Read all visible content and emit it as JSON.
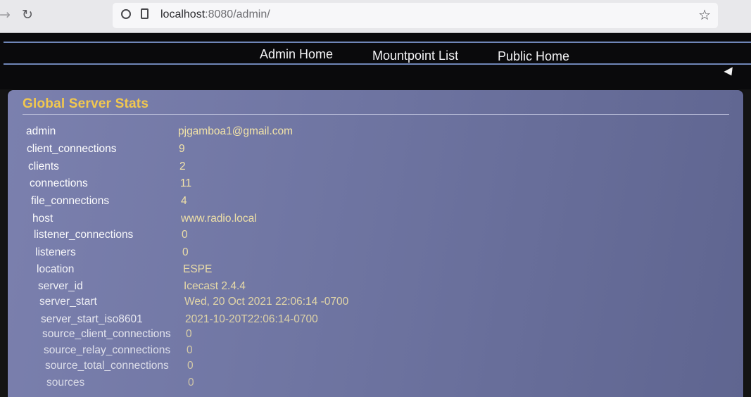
{
  "browser": {
    "url_host": "localhost",
    "url_rest": ":8080/admin/"
  },
  "menu": {
    "admin_home": "Admin Home",
    "mountpoint_list": "Mountpoint List",
    "public_home": "Public Home"
  },
  "stats": {
    "title": "Global Server Stats",
    "rows": [
      {
        "key": "admin",
        "value": "pjgamboa1@gmail.com"
      },
      {
        "key": "client_connections",
        "value": "9"
      },
      {
        "key": "clients",
        "value": "2"
      },
      {
        "key": "connections",
        "value": "11"
      },
      {
        "key": "file_connections",
        "value": "4"
      },
      {
        "key": "host",
        "value": "www.radio.local"
      },
      {
        "key": "listener_connections",
        "value": "0"
      },
      {
        "key": "listeners",
        "value": "0"
      },
      {
        "key": "location",
        "value": "ESPE"
      },
      {
        "key": "server_id",
        "value": "Icecast 2.4.4"
      },
      {
        "key": "server_start",
        "value": "Wed, 20 Oct 2021 22:06:14 -0700"
      },
      {
        "key": "server_start_iso8601",
        "value": "2021-10-20T22:06:14-0700"
      },
      {
        "key": "source_client_connections",
        "value": "0"
      },
      {
        "key": "source_relay_connections",
        "value": "0"
      },
      {
        "key": "source_total_connections",
        "value": "0"
      },
      {
        "key": "sources",
        "value": "0"
      }
    ]
  },
  "colors": {
    "panel_background": "#7076a3",
    "title_gold": "#f2c84e",
    "value_yellow": "#f3e4a8",
    "key_white": "#ffffff"
  },
  "icons": {
    "back": "back-arrow-icon",
    "reload": "reload-icon",
    "tracking_protection": "shield-icon",
    "page_info": "page-icon",
    "bookmark": "star-icon",
    "mouse_pointer": "cursor-icon"
  }
}
